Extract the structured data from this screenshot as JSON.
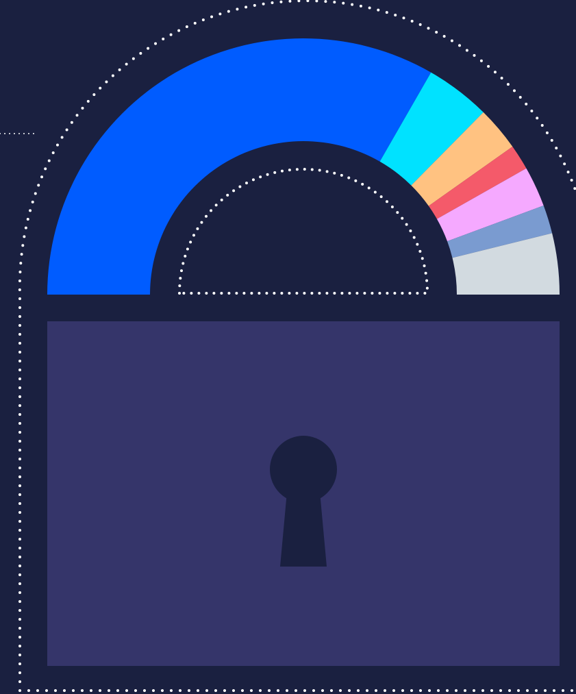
{
  "colors": {
    "background": "#1a2040",
    "lock_body": "#35356a",
    "keyhole": "#1a2040",
    "dotted_outline": "#ffffff"
  },
  "icons": {
    "padlock": "padlock-icon",
    "keyhole": "keyhole-icon"
  },
  "chart_data": {
    "type": "pie",
    "shape": "semicircle-donut",
    "title": "",
    "legend": "none",
    "slices": [
      {
        "value": 66.6,
        "color": "#005cff"
      },
      {
        "value": 8.2,
        "color": "#00e2ff"
      },
      {
        "value": 5.6,
        "color": "#ffc281"
      },
      {
        "value": 3.2,
        "color": "#f45a6a"
      },
      {
        "value": 5.1,
        "color": "#f5a9ff"
      },
      {
        "value": 3.6,
        "color": "#7a9bd0"
      },
      {
        "value": 7.7,
        "color": "#d2dae0"
      }
    ]
  }
}
